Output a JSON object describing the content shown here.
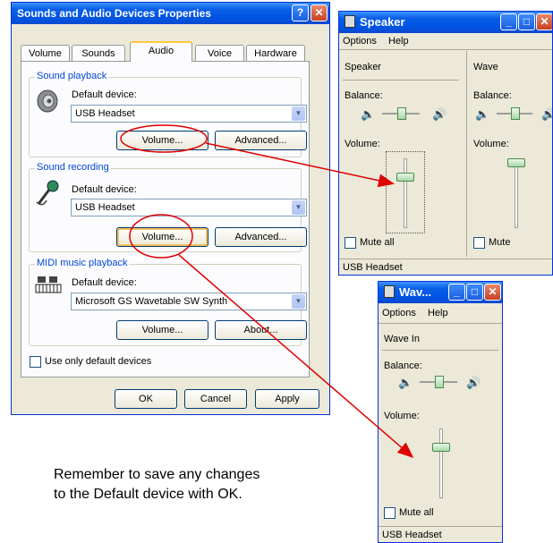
{
  "dialog": {
    "title": "Sounds and Audio Devices Properties",
    "help_button": "?",
    "close_button": "✕",
    "tabs": [
      {
        "label": "Volume"
      },
      {
        "label": "Sounds"
      },
      {
        "label": "Audio"
      },
      {
        "label": "Voice"
      },
      {
        "label": "Hardware"
      }
    ],
    "active_tab": "Audio",
    "playback": {
      "legend": "Sound playback",
      "default_label": "Default device:",
      "device": "USB Headset",
      "volume_button": "Volume...",
      "advanced_button": "Advanced..."
    },
    "recording": {
      "legend": "Sound recording",
      "default_label": "Default device:",
      "device": "USB Headset",
      "volume_button": "Volume...",
      "advanced_button": "Advanced..."
    },
    "midi": {
      "legend": "MIDI music playback",
      "default_label": "Default device:",
      "device": "Microsoft GS Wavetable SW Synth",
      "volume_button": "Volume...",
      "about_button": "About..."
    },
    "use_default_only": "Use only default devices",
    "ok": "OK",
    "cancel": "Cancel",
    "apply": "Apply"
  },
  "speaker_window": {
    "title": "Speaker",
    "menu": [
      "Options",
      "Help"
    ],
    "columns": [
      {
        "name": "Speaker",
        "balance": "Balance:",
        "volume": "Volume:",
        "mute": "Mute all"
      },
      {
        "name": "Wave",
        "balance": "Balance:",
        "volume": "Volume:",
        "mute": "Mute"
      }
    ],
    "status": "USB Headset"
  },
  "wave_window": {
    "title": "Wav...",
    "menu": [
      "Options",
      "Help"
    ],
    "name": "Wave In",
    "balance": "Balance:",
    "volume": "Volume:",
    "mute": "Mute all",
    "status": "USB Headset"
  },
  "caption": {
    "line1": "Remember to save any changes",
    "line2": "to the Default device with OK."
  },
  "colors": {
    "annotation_red": "#e00000",
    "xp_title_blue": "#0054e3",
    "window_face": "#ece9d8"
  }
}
